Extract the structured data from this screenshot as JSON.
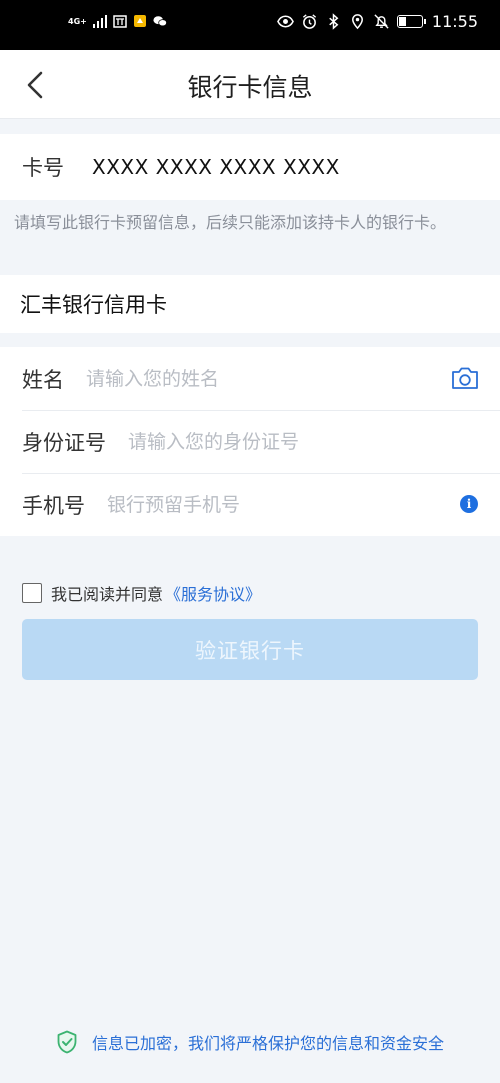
{
  "status_bar": {
    "network": "4G+",
    "time": "11:55",
    "battery_level": 0.3
  },
  "header": {
    "back_icon": "chevron-left-icon",
    "title": "银行卡信息"
  },
  "card": {
    "label": "卡号",
    "value": "XXXX  XXXX  XXXX  XXXX"
  },
  "notice": "请填写此银行卡预留信息，后续只能添加该持卡人的银行卡。",
  "bank_name": "汇丰银行信用卡",
  "form": {
    "name_label": "姓名",
    "name_placeholder": "请输入您的姓名",
    "id_label": "身份证号",
    "id_placeholder": "请输入您的身份证号",
    "phone_label": "手机号",
    "phone_placeholder": "银行预留手机号",
    "info_icon_text": "i"
  },
  "agreement": {
    "text": "我已阅读并同意",
    "link": "《服务协议》"
  },
  "verify_button": "验证银行卡",
  "footer": "信息已加密，我们将严格保护您的信息和资金安全",
  "colors": {
    "accent": "#2a6fd6",
    "button_disabled": "#b9d9f4",
    "page_bg": "#f2f5f9"
  }
}
